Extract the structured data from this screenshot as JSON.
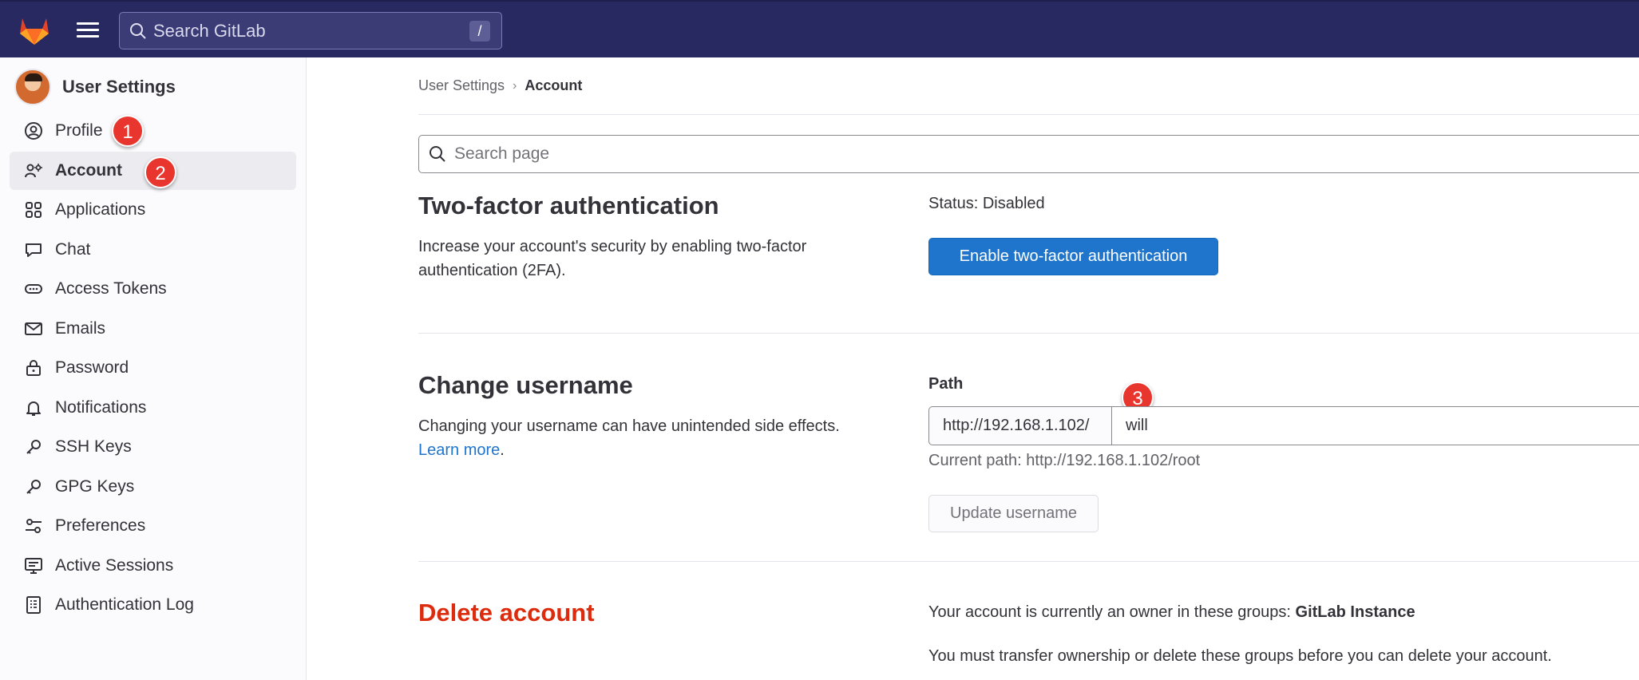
{
  "topbar": {
    "search_placeholder": "Search GitLab",
    "search_shortcut": "/"
  },
  "sidebar": {
    "title": "User Settings",
    "items": [
      {
        "label": "Profile",
        "icon": "profile-icon"
      },
      {
        "label": "Account",
        "icon": "account-icon",
        "active": true
      },
      {
        "label": "Applications",
        "icon": "applications-icon"
      },
      {
        "label": "Chat",
        "icon": "chat-icon"
      },
      {
        "label": "Access Tokens",
        "icon": "token-icon"
      },
      {
        "label": "Emails",
        "icon": "mail-icon"
      },
      {
        "label": "Password",
        "icon": "lock-icon"
      },
      {
        "label": "Notifications",
        "icon": "bell-icon"
      },
      {
        "label": "SSH Keys",
        "icon": "key-icon"
      },
      {
        "label": "GPG Keys",
        "icon": "key-icon"
      },
      {
        "label": "Preferences",
        "icon": "preferences-icon"
      },
      {
        "label": "Active Sessions",
        "icon": "monitor-icon"
      },
      {
        "label": "Authentication Log",
        "icon": "log-icon"
      }
    ]
  },
  "annotations": [
    "1",
    "2",
    "3"
  ],
  "breadcrumb": {
    "parent": "User Settings",
    "separator": "›",
    "current": "Account"
  },
  "page_search": {
    "placeholder": "Search page"
  },
  "two_factor": {
    "title": "Two-factor authentication",
    "description": "Increase your account's security by enabling two-factor authentication (2FA).",
    "status": "Status: Disabled",
    "button": "Enable two-factor authentication"
  },
  "change_username": {
    "title": "Change username",
    "description": "Changing your username can have unintended side effects.",
    "learn_more": "Learn more",
    "period": ".",
    "path_label": "Path",
    "path_prefix": "http://192.168.1.102/",
    "username_value": "will",
    "current_path": "Current path: http://192.168.1.102/root",
    "button": "Update username"
  },
  "delete_account": {
    "title": "Delete account",
    "owner_text": "Your account is currently an owner in these groups: ",
    "owner_group": "GitLab Instance",
    "transfer_text": "You must transfer ownership or delete these groups before you can delete your account."
  },
  "colors": {
    "topbar": "#292961",
    "primary": "#1f75cb",
    "danger": "#dd2b0e",
    "annotation": "#e8362f"
  }
}
